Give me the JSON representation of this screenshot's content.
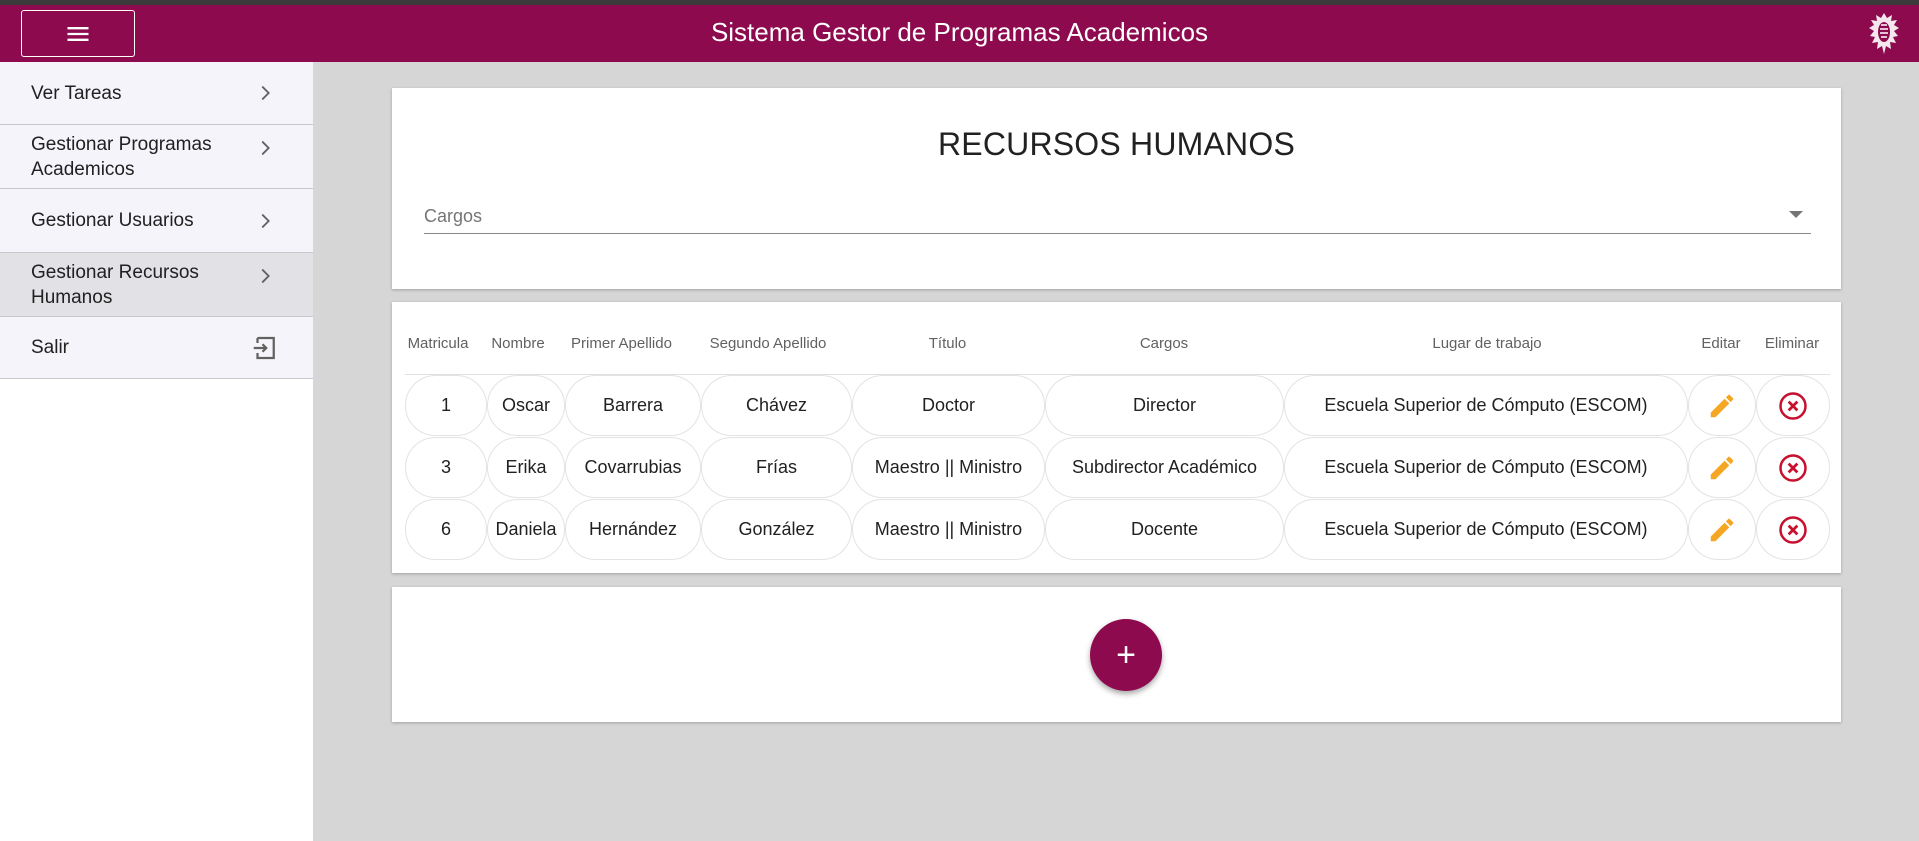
{
  "header": {
    "title": "Sistema Gestor de Programas Academicos",
    "menu_icon": "hamburger-menu-icon",
    "logo": "institution-logo"
  },
  "sidebar": {
    "items": [
      {
        "label": "Ver Tareas",
        "icon": "chevron-right-icon"
      },
      {
        "label": "Gestionar Programas Academicos",
        "icon": "chevron-right-icon"
      },
      {
        "label": "Gestionar Usuarios",
        "icon": "chevron-right-icon"
      },
      {
        "label": "Gestionar Recursos Humanos",
        "icon": "chevron-right-icon",
        "active": true
      },
      {
        "label": "Salir",
        "icon": "exit-icon"
      }
    ]
  },
  "main": {
    "title": "RECURSOS HUMANOS",
    "filter": {
      "placeholder": "Cargos"
    },
    "table": {
      "columns": [
        "Matricula",
        "Nombre",
        "Primer Apellido",
        "Segundo Apellido",
        "Título",
        "Cargos",
        "Lugar de trabajo",
        "Editar",
        "Eliminar"
      ],
      "rows": [
        [
          "1",
          "Oscar",
          "Barrera",
          "Chávez",
          "Doctor",
          "Director",
          "Escuela Superior de Cómputo (ESCOM)"
        ],
        [
          "3",
          "Erika",
          "Covarrubias",
          "Frías",
          "Maestro || Ministro",
          "Subdirector Académico",
          "Escuela Superior de Cómputo (ESCOM)"
        ],
        [
          "6",
          "Daniela",
          "Hernández",
          "González",
          "Maestro || Ministro",
          "Docente",
          "Escuela Superior de Cómputo (ESCOM)"
        ]
      ],
      "edit_icon": "pencil-icon",
      "delete_icon": "close-circle-icon"
    },
    "add_button": {
      "label": "+",
      "icon": "plus-icon"
    }
  },
  "colors": {
    "brand": "#8e0a4e",
    "edit": "#f5a623",
    "delete": "#c8102e",
    "background": "#d6d6d6"
  }
}
